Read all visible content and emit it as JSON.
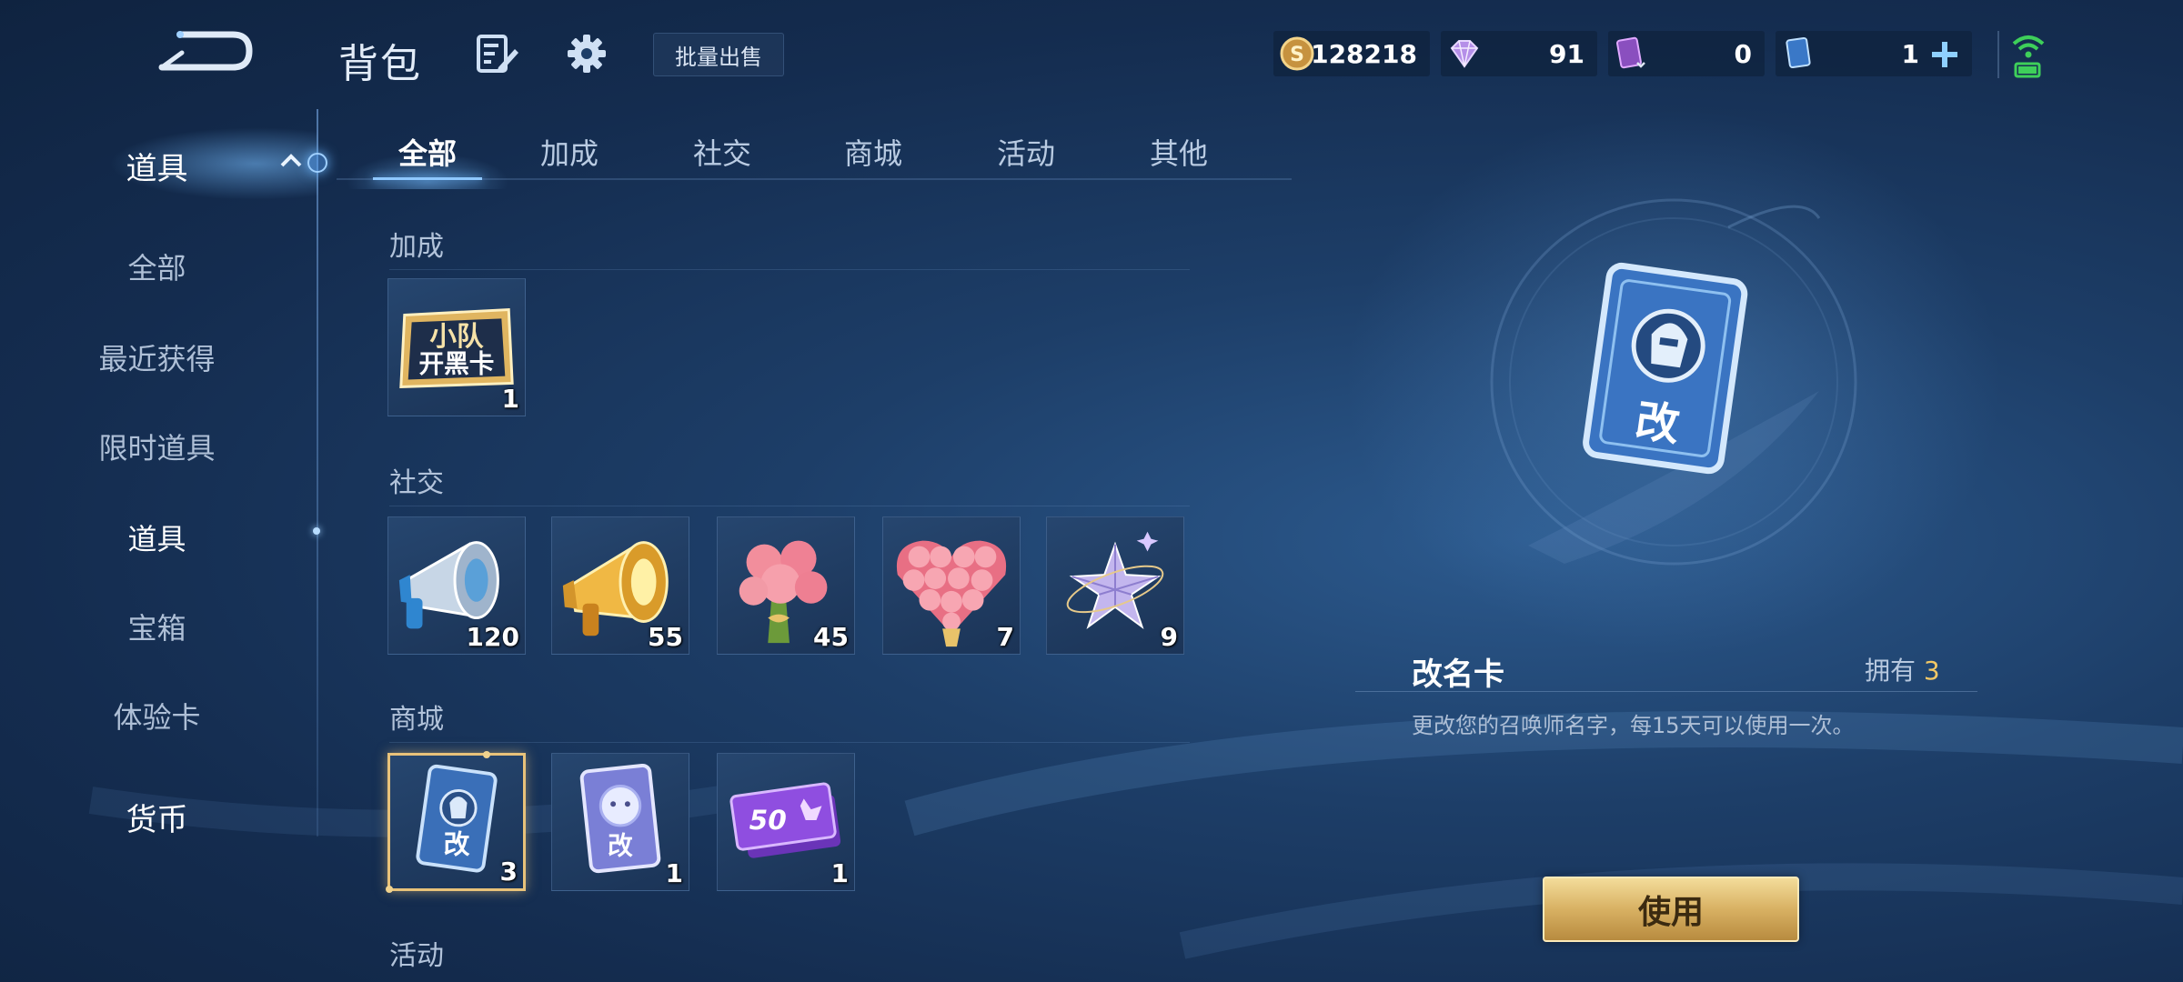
{
  "header": {
    "title": "背包",
    "batch_sell_label": "批量出售"
  },
  "currencies": [
    {
      "icon": "gold-coin-icon",
      "value": "128218"
    },
    {
      "icon": "diamond-icon",
      "value": "91"
    },
    {
      "icon": "card-ticket-icon",
      "value": "0"
    },
    {
      "icon": "blue-card-icon",
      "value": "1"
    }
  ],
  "left_nav": {
    "group_label": "道具",
    "items": [
      "全部",
      "最近获得",
      "限时道具",
      "道具",
      "宝箱",
      "体验卡",
      "货币"
    ],
    "selected": "道具"
  },
  "tabs": [
    "全部",
    "加成",
    "社交",
    "商城",
    "活动",
    "其他"
  ],
  "active_tab": "全部",
  "sections": [
    {
      "title": "加成",
      "items": [
        {
          "name": "小队开黑卡",
          "card_text": [
            "小队",
            "开黑卡"
          ],
          "count": "1"
        }
      ]
    },
    {
      "title": "社交",
      "items": [
        {
          "name": "silver-megaphone",
          "count": "120"
        },
        {
          "name": "gold-megaphone",
          "count": "55"
        },
        {
          "name": "rose-bouquet",
          "count": "45"
        },
        {
          "name": "heart-rose-bouquet",
          "count": "7"
        },
        {
          "name": "crystal-star",
          "count": "9"
        }
      ]
    },
    {
      "title": "商城",
      "items": [
        {
          "name": "rename-card",
          "card_char": "改",
          "count": "3",
          "selected": true
        },
        {
          "name": "rename-card-2",
          "card_char": "改",
          "count": "1"
        },
        {
          "name": "ticket-50",
          "ticket_text": "50",
          "count": "1"
        }
      ]
    },
    {
      "title": "活动",
      "items": []
    }
  ],
  "detail": {
    "card_char": "改",
    "name": "改名卡",
    "own_label": "拥有",
    "own_count": "3",
    "description": "更改您的召唤师名字，每15天可以使用一次。",
    "use_label": "使用"
  }
}
